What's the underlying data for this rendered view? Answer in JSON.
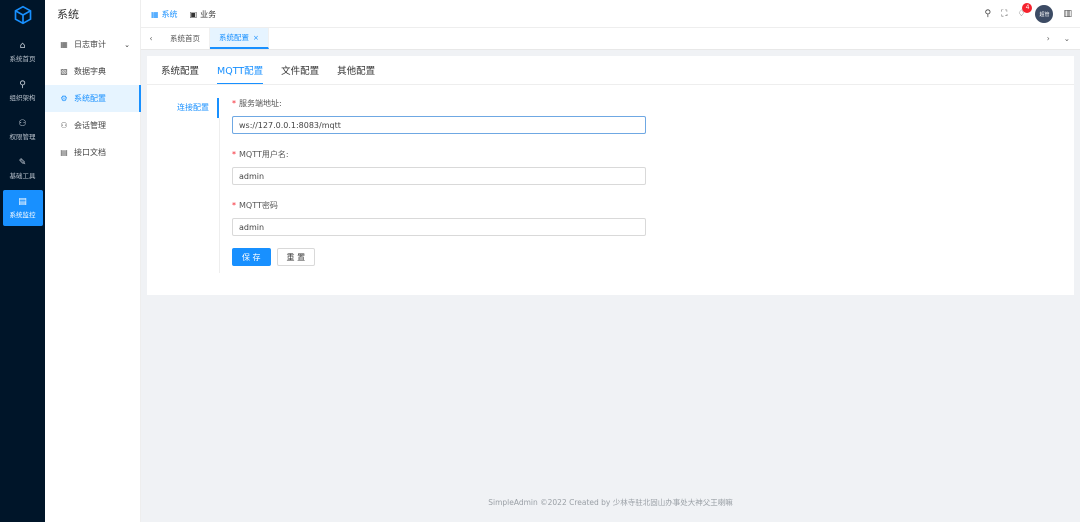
{
  "rail": {
    "items": [
      {
        "label": "系统首页",
        "icon": "⌂"
      },
      {
        "label": "组织架构",
        "icon": "⚲"
      },
      {
        "label": "权限管理",
        "icon": "⚇"
      },
      {
        "label": "基础工具",
        "icon": "✎"
      },
      {
        "label": "系统监控",
        "icon": "▤"
      }
    ]
  },
  "sidebar": {
    "title": "系统",
    "items": [
      {
        "label": "日志审计",
        "icon": "▦"
      },
      {
        "label": "数据字典",
        "icon": "▧"
      },
      {
        "label": "系统配置",
        "icon": "⚙"
      },
      {
        "label": "会话管理",
        "icon": "⚇"
      },
      {
        "label": "接口文档",
        "icon": "▤"
      }
    ],
    "chevron": "⌄"
  },
  "header": {
    "nav": [
      {
        "label": "系统",
        "icon": "▦"
      },
      {
        "label": "业务",
        "icon": "▣"
      }
    ],
    "notification_count": "4",
    "avatar_text": "超管",
    "icons": {
      "search": "⚲",
      "fullscreen": "⛶",
      "bell": "♢",
      "layout": "▥"
    }
  },
  "tabs": {
    "left_arrow": "‹",
    "items": [
      {
        "label": "系统首页"
      },
      {
        "label": "系统配置",
        "close": "×"
      }
    ],
    "right_arrow": "›",
    "down_arrow": "⌄"
  },
  "config": {
    "subtabs": [
      "系统配置",
      "MQTT配置",
      "文件配置",
      "其他配置"
    ],
    "vertical_tab": "连接配置",
    "fields": [
      {
        "label": "服务端地址:",
        "value": "ws://127.0.0.1:8083/mqtt"
      },
      {
        "label": "MQTT用户名:",
        "value": "admin"
      },
      {
        "label": "MQTT密码",
        "value": "admin"
      }
    ],
    "required_mark": "*",
    "save_label": "保 存",
    "reset_label": "重 置"
  },
  "footer": {
    "text": "SimpleAdmin ©2022 Created by 少林寺驻北固山办事处大神父王喇嘛"
  }
}
